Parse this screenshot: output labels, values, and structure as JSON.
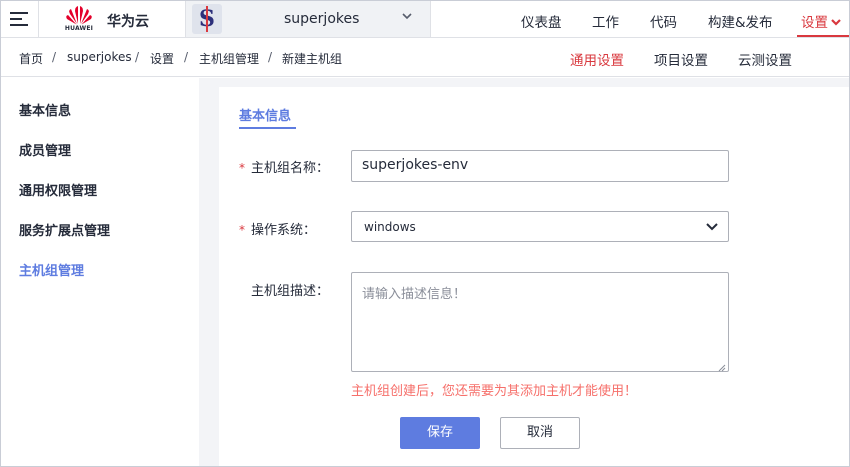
{
  "header": {
    "brand_name": "华为云",
    "brand_sub": "HUAWEI",
    "project_name": "superjokes",
    "nav": [
      {
        "label": "仪表盘"
      },
      {
        "label": "工作"
      },
      {
        "label": "代码"
      },
      {
        "label": "构建&发布"
      },
      {
        "label": "设置"
      }
    ],
    "active_nav": "设置"
  },
  "breadcrumb": [
    "首页",
    "superjokes",
    "设置",
    "主机组管理",
    "新建主机组"
  ],
  "breadcrumb_separator": "/",
  "subtabs": [
    {
      "label": "通用设置"
    },
    {
      "label": "项目设置"
    },
    {
      "label": "云测设置"
    }
  ],
  "active_subtab": "通用设置",
  "sidebar": {
    "items": [
      {
        "label": "基本信息"
      },
      {
        "label": "成员管理"
      },
      {
        "label": "通用权限管理"
      },
      {
        "label": "服务扩展点管理"
      },
      {
        "label": "主机组管理"
      }
    ],
    "active": "主机组管理"
  },
  "form": {
    "section_tab": "基本信息",
    "required_mark": "*",
    "name_label": "主机组名称：",
    "name_value": "superjokes-env",
    "os_label": "操作系统：",
    "os_value": "windows",
    "desc_label": "主机组描述：",
    "desc_placeholder": "请输入描述信息！",
    "hint": "主机组创建后，您还需要为其添加主机才能使用！",
    "save_label": "保存",
    "cancel_label": "取消"
  },
  "colors": {
    "accent_red": "#d9383e",
    "primary_blue": "#5e7ce0",
    "hint_red": "#f66f6a"
  }
}
